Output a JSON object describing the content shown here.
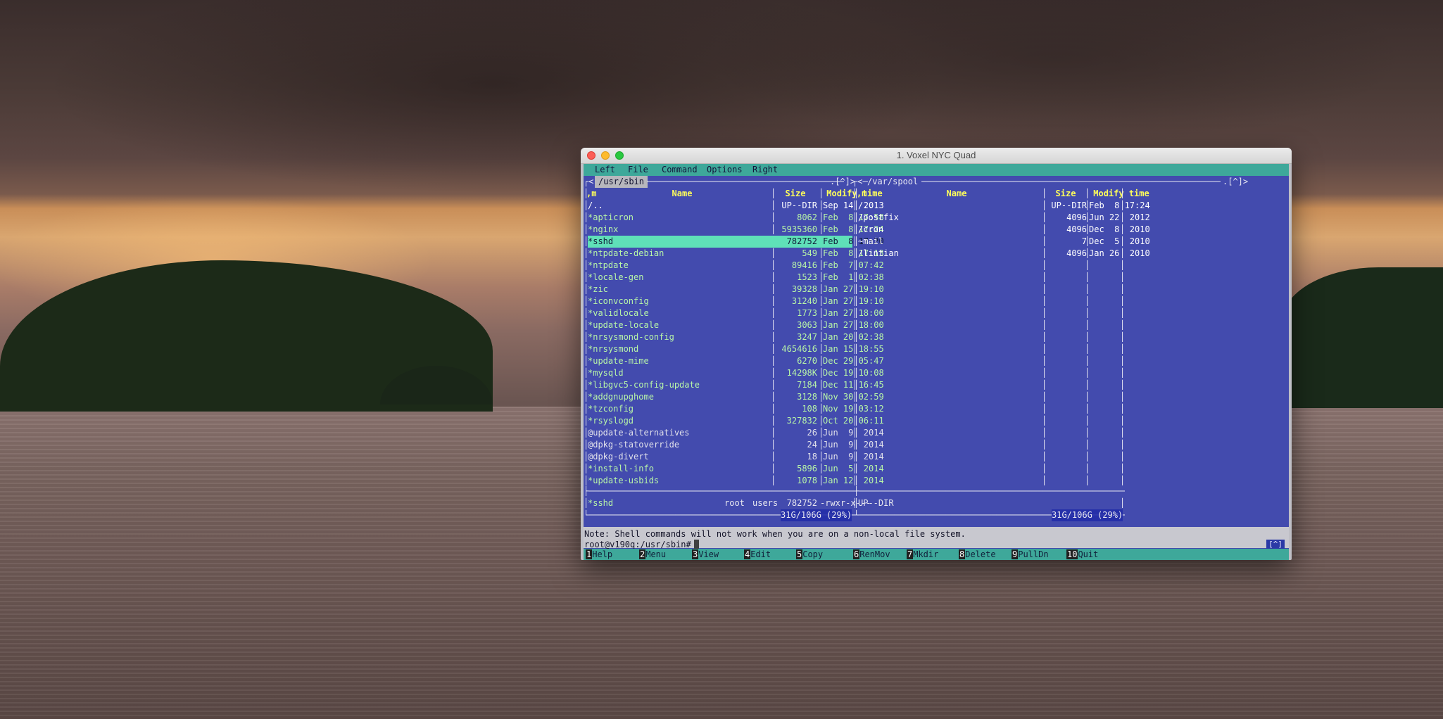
{
  "window": {
    "title": "1. Voxel NYC Quad"
  },
  "menu": [
    "Left",
    "File",
    "Command",
    "Options",
    "Right"
  ],
  "left_panel": {
    "path": "/usr/sbin",
    "corner": ".[^]>",
    "columns": {
      "sort": ",m",
      "name": "Name",
      "size": "Size",
      "mtime": "Modify time"
    },
    "rows": [
      {
        "name": "/..",
        "size": "UP--DIR",
        "mtime": "Sep 14  2013",
        "kind": "dir"
      },
      {
        "name": "*apticron",
        "size": "8062",
        "mtime": "Feb  8 17:58",
        "kind": "exe"
      },
      {
        "name": "*nginx",
        "size": "5935360",
        "mtime": "Feb  8 17:24",
        "kind": "exe"
      },
      {
        "name": "*sshd",
        "size": "782752",
        "mtime": "Feb  8 17:20",
        "kind": "exe",
        "selected": true
      },
      {
        "name": "*ntpdate-debian",
        "size": "549",
        "mtime": "Feb  8 17:13",
        "kind": "exe"
      },
      {
        "name": "*ntpdate",
        "size": "89416",
        "mtime": "Feb  7 07:42",
        "kind": "exe"
      },
      {
        "name": "*locale-gen",
        "size": "1523",
        "mtime": "Feb  1 02:38",
        "kind": "exe"
      },
      {
        "name": "*zic",
        "size": "39328",
        "mtime": "Jan 27 19:10",
        "kind": "exe"
      },
      {
        "name": "*iconvconfig",
        "size": "31240",
        "mtime": "Jan 27 19:10",
        "kind": "exe"
      },
      {
        "name": "*validlocale",
        "size": "1773",
        "mtime": "Jan 27 18:00",
        "kind": "exe"
      },
      {
        "name": "*update-locale",
        "size": "3063",
        "mtime": "Jan 27 18:00",
        "kind": "exe"
      },
      {
        "name": "*nrsysmond-config",
        "size": "3247",
        "mtime": "Jan 20 02:38",
        "kind": "exe"
      },
      {
        "name": "*nrsysmond",
        "size": "4654616",
        "mtime": "Jan 15 18:55",
        "kind": "exe"
      },
      {
        "name": "*update-mime",
        "size": "6270",
        "mtime": "Dec 29 05:47",
        "kind": "exe"
      },
      {
        "name": "*mysqld",
        "size": "14298K",
        "mtime": "Dec 19 10:08",
        "kind": "exe"
      },
      {
        "name": "*libgvc5-config-update",
        "size": "7184",
        "mtime": "Dec 11 16:45",
        "kind": "exe"
      },
      {
        "name": "*addgnupghome",
        "size": "3128",
        "mtime": "Nov 30 02:59",
        "kind": "exe"
      },
      {
        "name": "*tzconfig",
        "size": "108",
        "mtime": "Nov 19 03:12",
        "kind": "exe"
      },
      {
        "name": "*rsyslogd",
        "size": "327832",
        "mtime": "Oct 20 06:11",
        "kind": "exe"
      },
      {
        "name": "@update-alternatives",
        "size": "26",
        "mtime": "Jun  9  2014",
        "kind": "link"
      },
      {
        "name": "@dpkg-statoverride",
        "size": "24",
        "mtime": "Jun  9  2014",
        "kind": "link"
      },
      {
        "name": "@dpkg-divert",
        "size": "18",
        "mtime": "Jun  9  2014",
        "kind": "link"
      },
      {
        "name": "*install-info",
        "size": "5896",
        "mtime": "Jun  5  2014",
        "kind": "exe"
      },
      {
        "name": "*update-usbids",
        "size": "1078",
        "mtime": "Jan 12  2014",
        "kind": "exe"
      }
    ],
    "status": {
      "name": "*sshd",
      "owner": "root",
      "group": "users",
      "size": "782752",
      "perms": "-rwxr-x---"
    },
    "disk": "31G/106G (29%)"
  },
  "right_panel": {
    "path": "/var/spool",
    "corner": ".[^]>",
    "columns": {
      "sort": ",m",
      "name": "Name",
      "size": "Size",
      "mtime": "Modify time"
    },
    "rows": [
      {
        "name": "/..",
        "size": "UP--DIR",
        "mtime": "Feb  8 17:24",
        "kind": "dir"
      },
      {
        "name": "/postfix",
        "size": "4096",
        "mtime": "Jun 22  2012",
        "kind": "dir"
      },
      {
        "name": "/cron",
        "size": "4096",
        "mtime": "Dec  8  2010",
        "kind": "dir"
      },
      {
        "name": "~mail",
        "size": "7",
        "mtime": "Dec  5  2010",
        "kind": "dir"
      },
      {
        "name": "/lintian",
        "size": "4096",
        "mtime": "Jan 26  2010",
        "kind": "dir"
      }
    ],
    "status": {
      "name": "UP--DIR"
    },
    "disk": "31G/106G (29%)"
  },
  "note": "Note: Shell commands will not work when you are on a non-local file system.",
  "prompt": "root@v190q:/usr/sbin#",
  "prompt_corner": "[^]",
  "fkeys": [
    {
      "n": "1",
      "label": "Help"
    },
    {
      "n": "2",
      "label": "Menu"
    },
    {
      "n": "3",
      "label": "View"
    },
    {
      "n": "4",
      "label": "Edit"
    },
    {
      "n": "5",
      "label": "Copy"
    },
    {
      "n": "6",
      "label": "RenMov"
    },
    {
      "n": "7",
      "label": "Mkdir"
    },
    {
      "n": "8",
      "label": "Delete"
    },
    {
      "n": "9",
      "label": "PullDn"
    },
    {
      "n": "10",
      "label": "Quit"
    }
  ]
}
